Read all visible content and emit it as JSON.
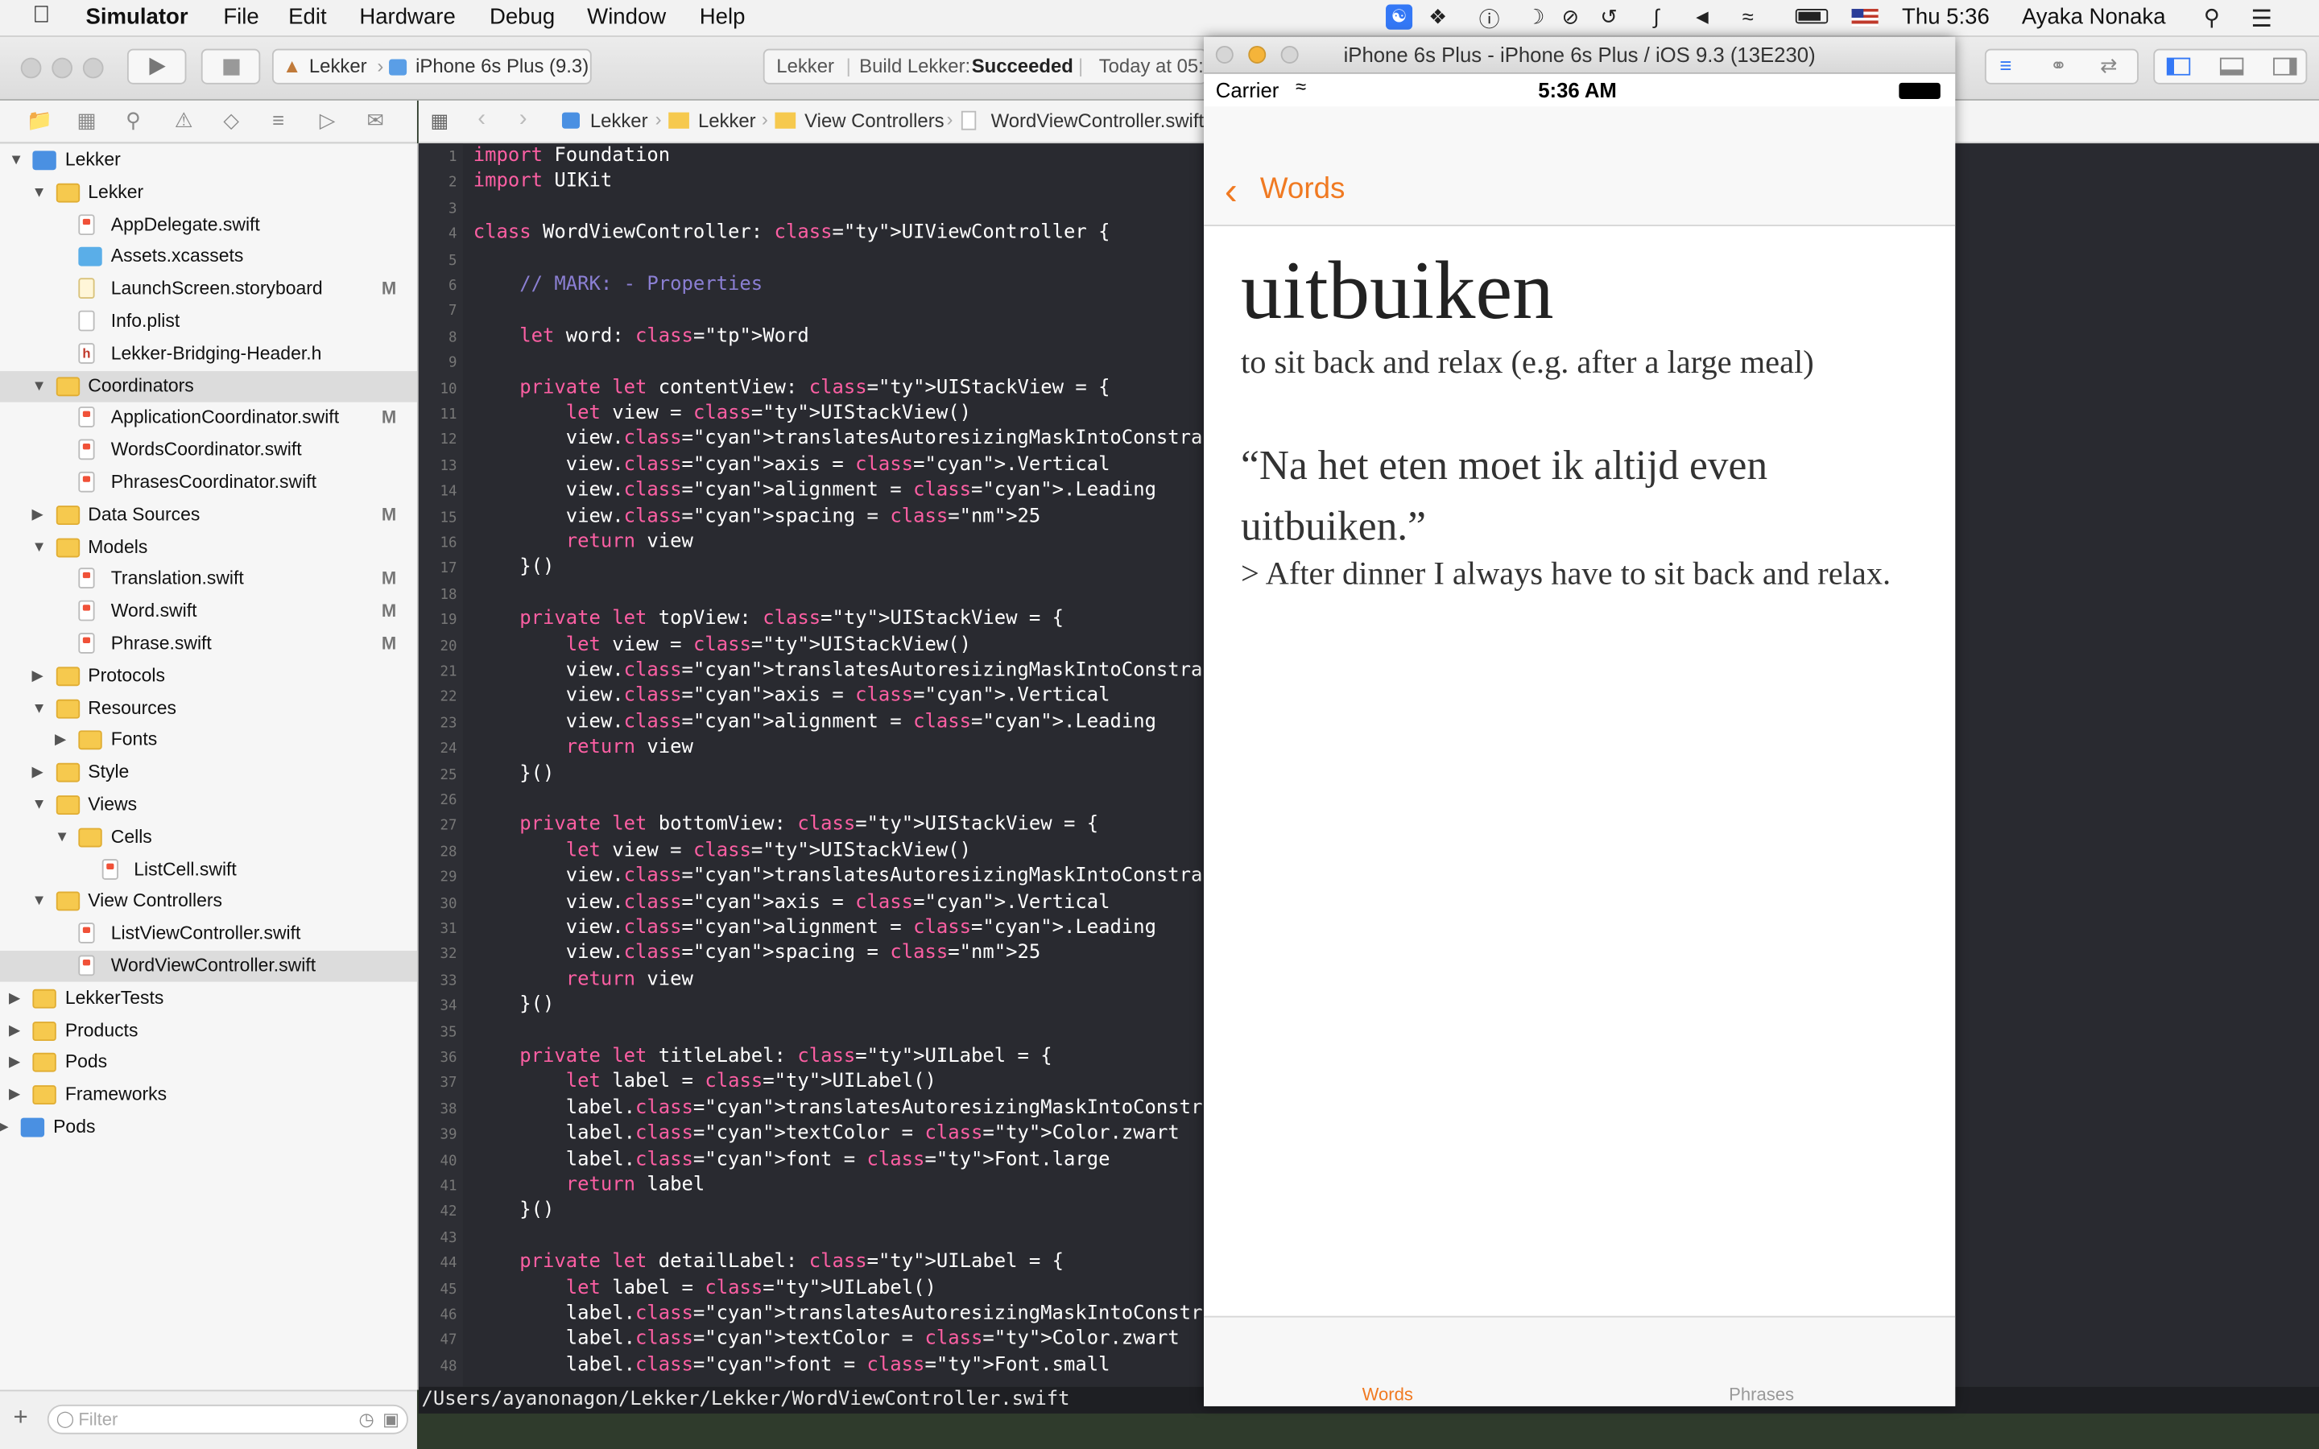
{
  "menubar": {
    "app": "Simulator",
    "items": [
      "File",
      "Edit",
      "Hardware",
      "Debug",
      "Window",
      "Help"
    ],
    "clock": "Thu 5:36",
    "user": "Ayaka Nonaka"
  },
  "toolbar": {
    "scheme": "Lekker",
    "device": "iPhone 6s Plus (9.3)",
    "status_project": "Lekker",
    "status_build_label": "Build Lekker:",
    "status_build_result": "Succeeded",
    "status_time": "Today at 05:"
  },
  "jumpbar": {
    "crumbs": [
      "Lekker",
      "Lekker",
      "View Controllers",
      "WordViewController.swift"
    ]
  },
  "navigator": {
    "rows": [
      {
        "label": "Lekker",
        "mark": ""
      },
      {
        "label": "Lekker",
        "mark": ""
      },
      {
        "label": "AppDelegate.swift",
        "mark": ""
      },
      {
        "label": "Assets.xcassets",
        "mark": ""
      },
      {
        "label": "LaunchScreen.storyboard",
        "mark": "M"
      },
      {
        "label": "Info.plist",
        "mark": ""
      },
      {
        "label": "Lekker-Bridging-Header.h",
        "mark": ""
      },
      {
        "label": "Coordinators",
        "mark": ""
      },
      {
        "label": "ApplicationCoordinator.swift",
        "mark": "M"
      },
      {
        "label": "WordsCoordinator.swift",
        "mark": ""
      },
      {
        "label": "PhrasesCoordinator.swift",
        "mark": ""
      },
      {
        "label": "Data Sources",
        "mark": "M"
      },
      {
        "label": "Models",
        "mark": ""
      },
      {
        "label": "Translation.swift",
        "mark": "M"
      },
      {
        "label": "Word.swift",
        "mark": "M"
      },
      {
        "label": "Phrase.swift",
        "mark": "M"
      },
      {
        "label": "Protocols",
        "mark": ""
      },
      {
        "label": "Resources",
        "mark": ""
      },
      {
        "label": "Fonts",
        "mark": ""
      },
      {
        "label": "Style",
        "mark": ""
      },
      {
        "label": "Views",
        "mark": ""
      },
      {
        "label": "Cells",
        "mark": ""
      },
      {
        "label": "ListCell.swift",
        "mark": ""
      },
      {
        "label": "View Controllers",
        "mark": ""
      },
      {
        "label": "ListViewController.swift",
        "mark": ""
      },
      {
        "label": "WordViewController.swift",
        "mark": ""
      },
      {
        "label": "LekkerTests",
        "mark": ""
      },
      {
        "label": "Products",
        "mark": ""
      },
      {
        "label": "Pods",
        "mark": ""
      },
      {
        "label": "Frameworks",
        "mark": ""
      },
      {
        "label": "Pods",
        "mark": ""
      }
    ],
    "filter_placeholder": "Filter"
  },
  "editor": {
    "line_numbers": [
      "1",
      "2",
      "3",
      "4",
      "5",
      "6",
      "7",
      "8",
      "9",
      "10",
      "11",
      "12",
      "13",
      "14",
      "15",
      "16",
      "17",
      "18",
      "19",
      "20",
      "21",
      "22",
      "23",
      "24",
      "25",
      "26",
      "27",
      "28",
      "29",
      "30",
      "31",
      "32",
      "33",
      "34",
      "35",
      "36",
      "37",
      "38",
      "39",
      "40",
      "41",
      "42",
      "43",
      "44",
      "45",
      "46",
      "47",
      "48"
    ],
    "lines": [
      "import Foundation",
      "import UIKit",
      "",
      "class WordViewController: UIViewController {",
      "",
      "    // MARK: - Properties",
      "",
      "    let word: Word",
      "",
      "    private let contentView: UIStackView = {",
      "        let view = UIStackView()",
      "        view.translatesAutoresizingMaskIntoConstraints = false",
      "        view.axis = .Vertical",
      "        view.alignment = .Leading",
      "        view.spacing = 25",
      "        return view",
      "    }()",
      "",
      "    private let topView: UIStackView = {",
      "        let view = UIStackView()",
      "        view.translatesAutoresizingMaskIntoConstraints = false",
      "        view.axis = .Vertical",
      "        view.alignment = .Leading",
      "        return view",
      "    }()",
      "",
      "    private let bottomView: UIStackView = {",
      "        let view = UIStackView()",
      "        view.translatesAutoresizingMaskIntoConstraints = false",
      "        view.axis = .Vertical",
      "        view.alignment = .Leading",
      "        view.spacing = 25",
      "        return view",
      "    }()",
      "",
      "    private let titleLabel: UILabel = {",
      "        let label = UILabel()",
      "        label.translatesAutoresizingMaskIntoConstraints = false",
      "        label.textColor = Color.zwart",
      "        label.font = Font.large",
      "        return label",
      "    }()",
      "",
      "    private let detailLabel: UILabel = {",
      "        let label = UILabel()",
      "        label.translatesAutoresizingMaskIntoConstraints = false",
      "        label.textColor = Color.zwart",
      "        label.font = Font.small"
    ],
    "path": "/Users/ayanonagon/Lekker/Lekker/WordViewController.swift"
  },
  "simulator": {
    "window_title": "iPhone 6s Plus - iPhone 6s Plus / iOS 9.3 (13E230)",
    "carrier": "Carrier",
    "time": "5:36 AM",
    "back_label": "Words",
    "word": "uitbuiken",
    "definition": "to sit back and relax (e.g. after a large meal)",
    "example": "“Na het eten moet ik altijd even uitbuiken.”",
    "translation": "> After dinner I always have to sit back and relax.",
    "tabs": [
      "Words",
      "Phrases"
    ],
    "accent_color": "#f07a22"
  }
}
